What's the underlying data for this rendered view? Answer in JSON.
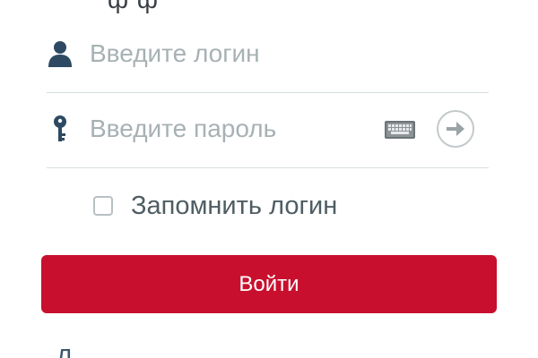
{
  "header": {
    "title_partial": "ф ф"
  },
  "login_field": {
    "icon": "user-icon",
    "placeholder": "Введите логин",
    "value": ""
  },
  "password_field": {
    "icon": "key-icon",
    "placeholder": "Введите пароль",
    "value": "",
    "keyboard_icon": "keyboard-icon",
    "submit_icon": "arrow-right-icon"
  },
  "remember": {
    "label": "Запомнить логин",
    "checked": false
  },
  "login_button": {
    "label": "Войти"
  },
  "footer": {
    "link_partial": "Д"
  },
  "colors": {
    "accent": "#c8102e",
    "divider": "#d6dfe0",
    "placeholder": "#a7b1b4",
    "icon_dark": "#2e4a62"
  }
}
